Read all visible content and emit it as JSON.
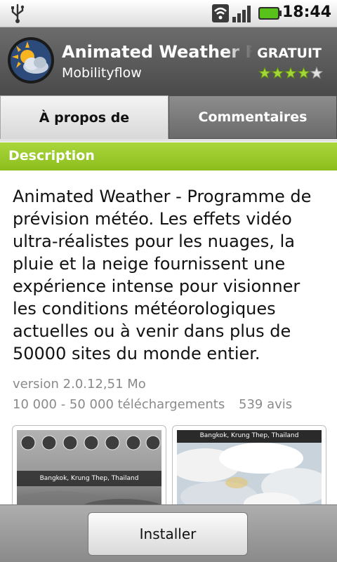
{
  "status_bar": {
    "time": "18:44",
    "icons": [
      "usb-icon",
      "wifi-icon",
      "signal-icon",
      "battery-icon"
    ],
    "battery_color": "#58c21b"
  },
  "app": {
    "title": "Animated Weather Fr",
    "price": "GRATUIT",
    "developer": "Mobilityflow",
    "rating": 4,
    "rating_max": 5,
    "icon": "weather-app-icon"
  },
  "tabs": [
    {
      "label": "À propos de",
      "active": true
    },
    {
      "label": "Commentaires",
      "active": false
    }
  ],
  "section": {
    "title": "Description",
    "accent_color": "#9ccb2b"
  },
  "description": "Animated Weather - Programme de\nprévision météo.  Les effets vidéo\nultra-réalistes pour les nuages, la\npluie et la neige fournissent une\nexpérience intense pour visionner\nles conditions météorologiques\nactuelles ou à venir dans plus de\n50000 sites du monde entier.",
  "meta": {
    "version": "version 2.0.12,51 Mo",
    "downloads": "10 000 - 50 000 téléchargements",
    "reviews": "539 avis"
  },
  "screenshots": [
    {
      "name": "screenshot-1",
      "caption": "Bangkok, Krung Thep, Thailand"
    },
    {
      "name": "screenshot-2",
      "caption": "Bangkok, Krung Thep, Thailand"
    }
  ],
  "install_button": {
    "label": "Installer"
  }
}
